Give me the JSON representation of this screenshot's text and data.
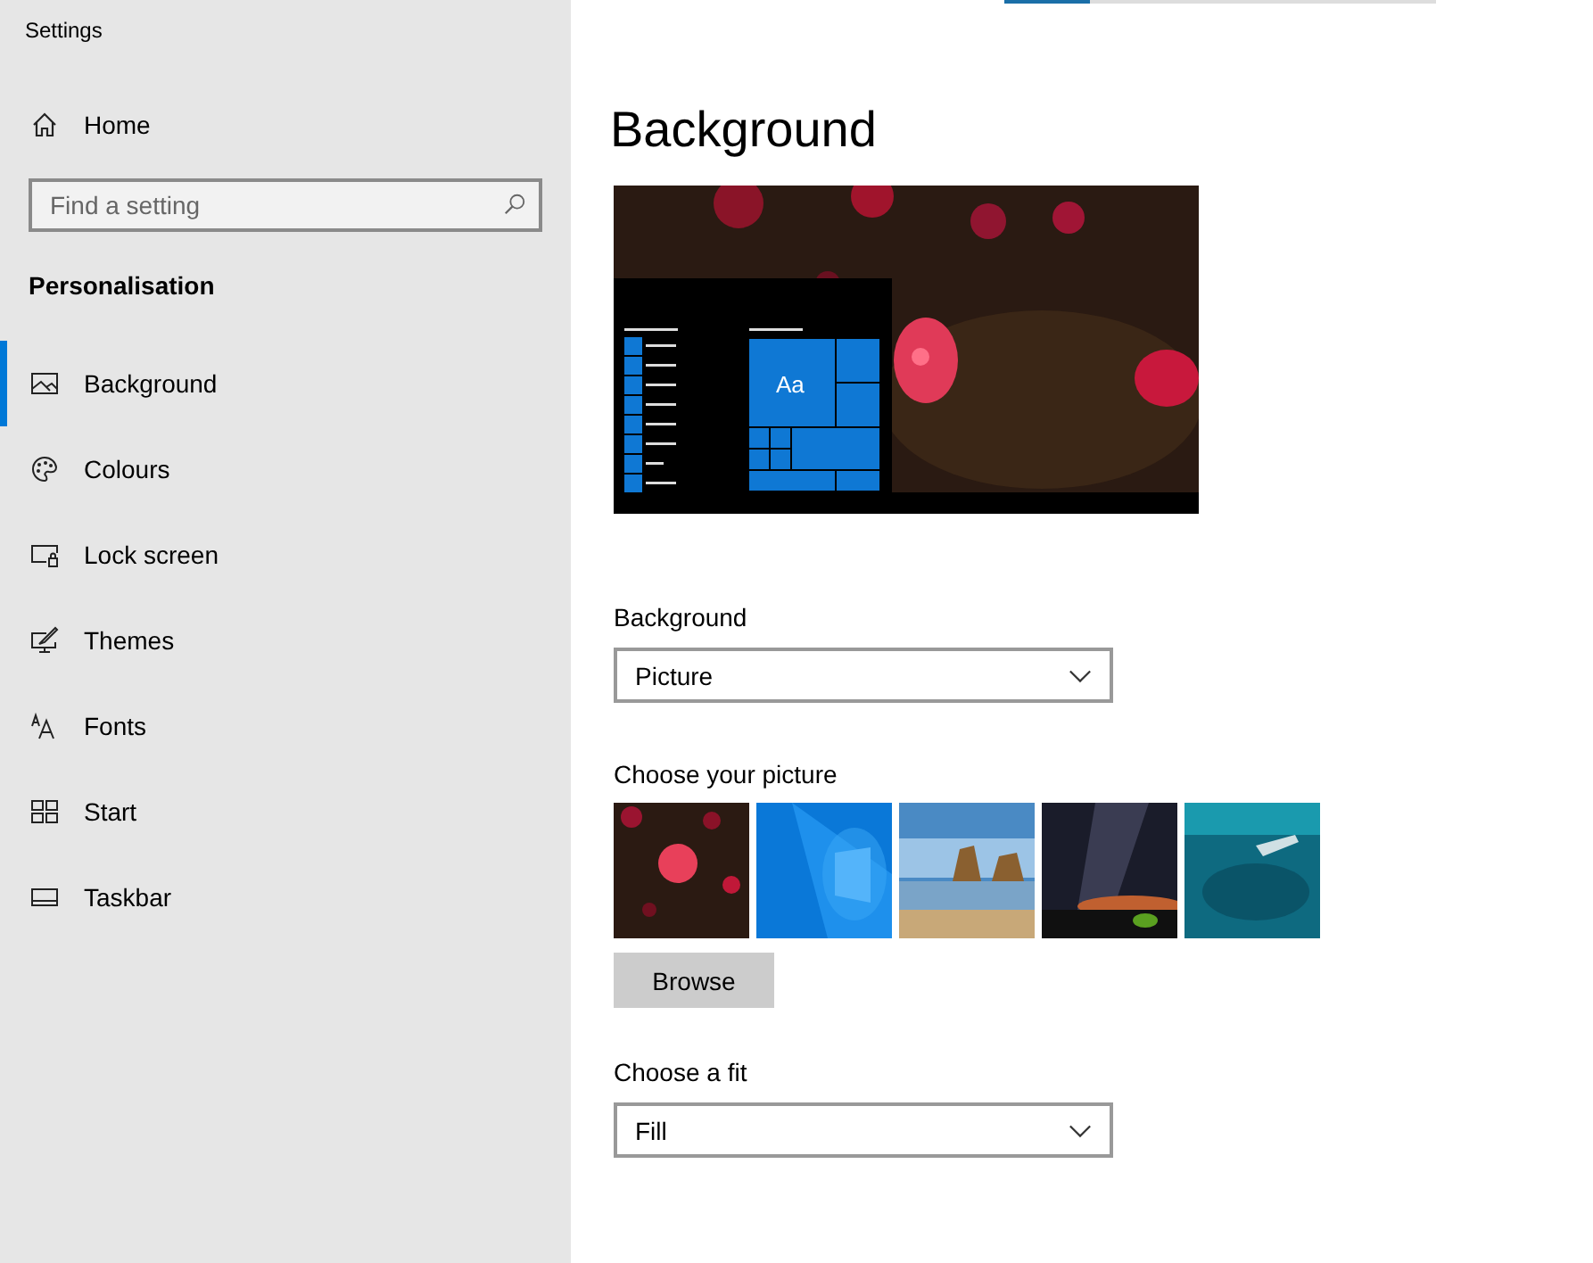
{
  "window": {
    "title": "Settings"
  },
  "sidebar": {
    "home": "Home",
    "search": {
      "placeholder": "Find a setting"
    },
    "section": "Personalisation",
    "items": [
      {
        "label": "Background",
        "kind": "background",
        "selected": true
      },
      {
        "label": "Colours",
        "kind": "colours",
        "selected": false
      },
      {
        "label": "Lock screen",
        "kind": "lock",
        "selected": false
      },
      {
        "label": "Themes",
        "kind": "themes",
        "selected": false
      },
      {
        "label": "Fonts",
        "kind": "fonts",
        "selected": false
      },
      {
        "label": "Start",
        "kind": "start",
        "selected": false
      },
      {
        "label": "Taskbar",
        "kind": "taskbar",
        "selected": false
      }
    ]
  },
  "page": {
    "title": "Background",
    "preview": {
      "tile_text": "Aa"
    },
    "background": {
      "label": "Background",
      "value": "Picture"
    },
    "choose_picture": {
      "label": "Choose your picture",
      "browse": "Browse"
    },
    "fit": {
      "label": "Choose a fit",
      "value": "Fill"
    }
  }
}
